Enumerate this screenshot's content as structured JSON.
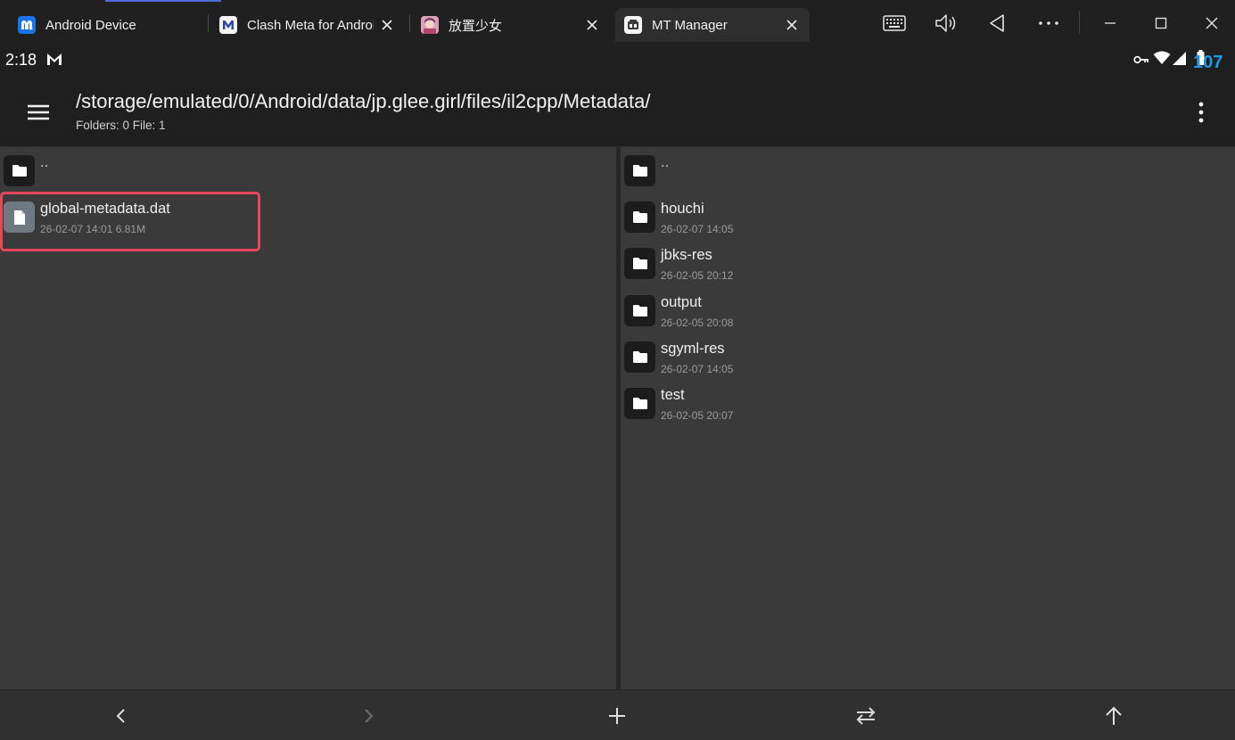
{
  "window": {
    "tabs": [
      {
        "title": "Android Device",
        "icon": "android-device-app-icon",
        "active": false,
        "closable": false
      },
      {
        "title": "Clash Meta for Android",
        "icon": "clash-meta-app-icon",
        "active": false,
        "closable": true
      },
      {
        "title": "放置少女",
        "icon": "game-app-icon",
        "active": false,
        "closable": true
      },
      {
        "title": "MT Manager",
        "icon": "mt-manager-app-icon",
        "active": true,
        "closable": true
      }
    ],
    "controls": [
      "keyboard-icon",
      "volume-icon",
      "back-triangle-icon",
      "more-horizontal-icon",
      "minimize-icon",
      "maximize-icon",
      "close-icon"
    ]
  },
  "statusbar": {
    "time": "2:18",
    "notification_icon": "gmail-m-icon",
    "icons": [
      "vpn-key-icon",
      "wifi-icon",
      "signal-icon",
      "battery-icon"
    ],
    "battery_overlay": "107"
  },
  "toolbar": {
    "path": "/storage/emulated/0/Android/data/jp.glee.girl/files/il2cpp/Metadata/",
    "counts": "Folders: 0  File: 1"
  },
  "left_pane": {
    "parent_label": "..",
    "items": [
      {
        "name": "global-metadata.dat",
        "meta": "26-02-07 14:01  6.81M",
        "type": "file",
        "highlighted": true
      }
    ]
  },
  "right_pane": {
    "parent_label": "..",
    "items": [
      {
        "name": "houchi",
        "meta": "26-02-07 14:05",
        "type": "folder"
      },
      {
        "name": "jbks-res",
        "meta": "26-02-05 20:12",
        "type": "folder"
      },
      {
        "name": "output",
        "meta": "26-02-05 20:08",
        "type": "folder"
      },
      {
        "name": "sgyml-res",
        "meta": "26-02-07 14:05",
        "type": "folder"
      },
      {
        "name": "test",
        "meta": "26-02-05 20:07",
        "type": "folder"
      }
    ]
  },
  "bottombar": {
    "buttons": [
      "back-arrow-icon",
      "forward-arrow-icon",
      "add-icon",
      "swap-icon",
      "up-arrow-icon"
    ]
  },
  "colors": {
    "highlight": "#e5485a",
    "battery_text": "#1e9ae6",
    "accent_tab_line": "#4f6bd6"
  }
}
